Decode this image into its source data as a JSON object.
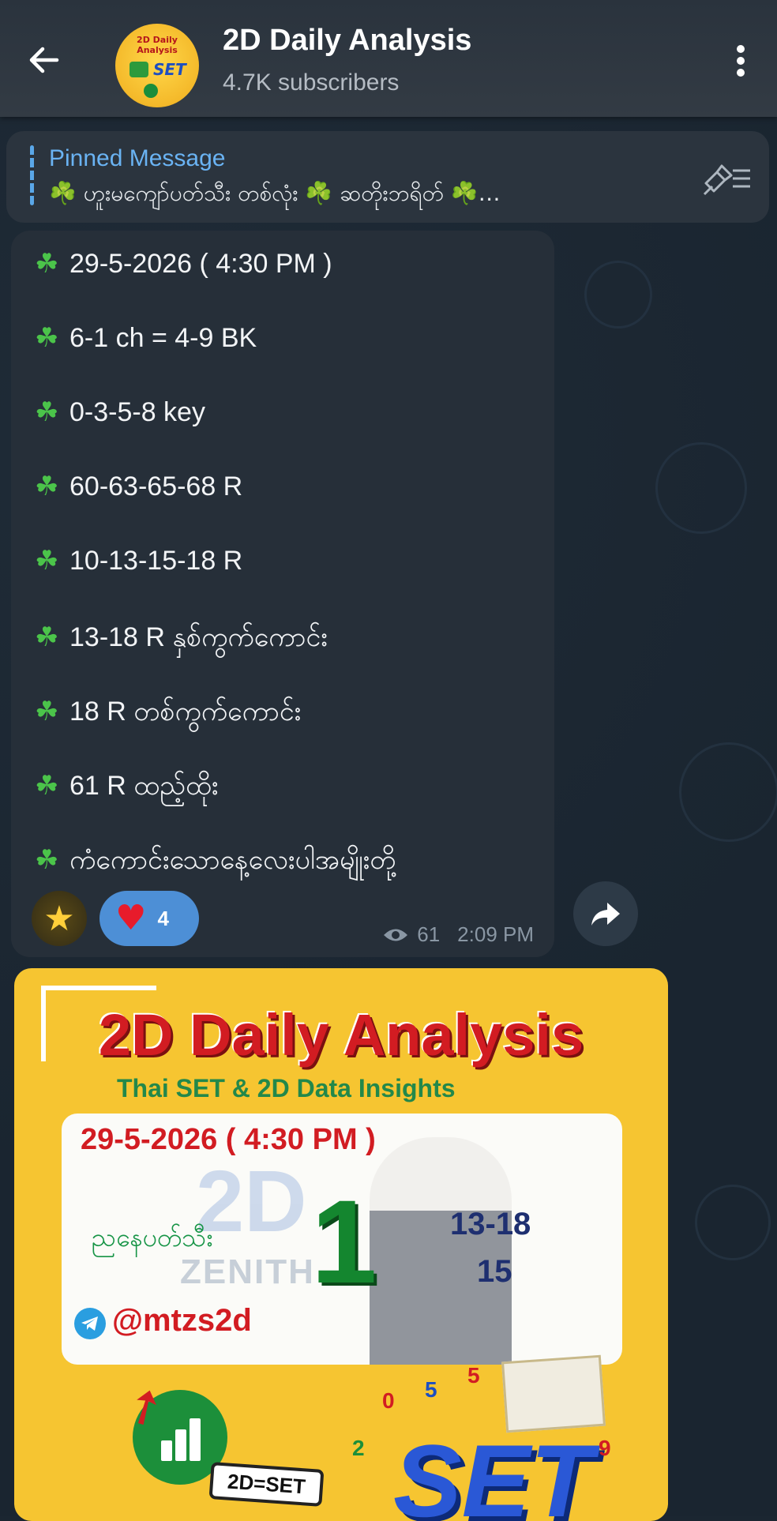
{
  "header": {
    "back_icon": "arrow-left-icon",
    "title": "2D Daily Analysis",
    "subtitle": "4.7K subscribers",
    "avatar_text": "2D Daily Analysis",
    "avatar_set": "SET",
    "menu_icon": "more-vertical-icon"
  },
  "pinned": {
    "title": "Pinned Message",
    "text": "☘️ ဟူးမကျော်ပတ်သီး တစ်လုံး ☘️ ဆတိုးဘရိတ် ☘️…",
    "icon": "pinned-list-icon"
  },
  "message": {
    "lines": [
      "29-5-2026 ( 4:30 PM )",
      "6-1 ch =  4-9 BK",
      "0-3-5-8 key",
      "60-63-65-68 R",
      "10-13-15-18 R",
      "13-18 R နှစ်ကွက်ကောင်း",
      "18 R တစ်ကွက်ကောင်း",
      "61 R  ထည့်ထိုး",
      "ကံကောင်းသောနေ့လေးပါအမျိုးတို့"
    ],
    "bullet": "☘",
    "reactions": {
      "star_icon": "star-icon",
      "heart_icon": "heart-icon",
      "heart_count": "4"
    },
    "views": "61",
    "time": "2:09 PM"
  },
  "share_icon": "share-icon",
  "photo": {
    "title": "2D Daily Analysis",
    "subtitle": "Thai SET & 2D Data Insights",
    "date": "29-5-2026 ( 4:30 PM )",
    "logo_2d": "2D",
    "logo_team": "ZENITH",
    "big_number": "1",
    "label": "ညနေပတ်သီး",
    "number_1": "13-18",
    "number_2": "15",
    "handle": "@mtzs2d",
    "badge": "2D=SET",
    "set_logo": "SET",
    "digits": [
      "0",
      "5",
      "5",
      "2",
      "9"
    ]
  },
  "colors": {
    "background": "#1b2631",
    "bubble": "#262f39",
    "accent_blue": "#6ab3f3",
    "clover_green": "#4bc44a",
    "photo_yellow": "#f6c531",
    "title_red": "#d21c22"
  }
}
